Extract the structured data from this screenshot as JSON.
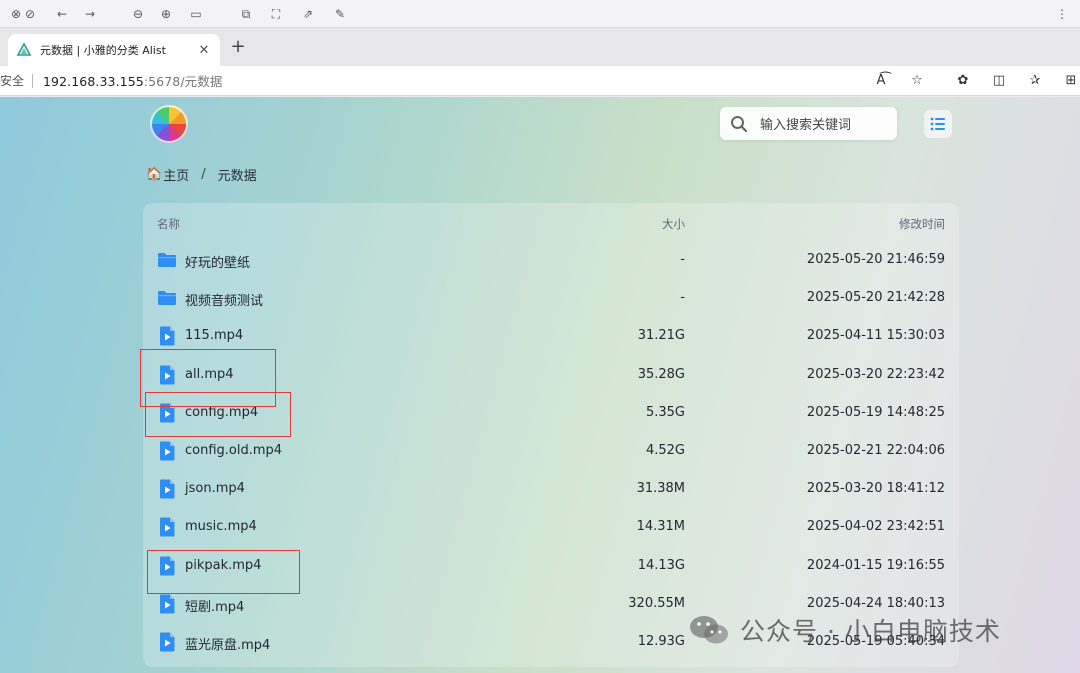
{
  "browser": {
    "tab_title": "元数据 | 小雅的分类 Alist",
    "new_tab": "+",
    "security_label": "安全",
    "url_host": "192.168.33.155",
    "url_rest": ":5678/元数据"
  },
  "header": {
    "search_placeholder": "输入搜索关键词"
  },
  "breadcrumb": {
    "home_label": "主页",
    "separator": "/",
    "current": "元数据"
  },
  "list": {
    "columns": {
      "name": "名称",
      "size": "大小",
      "modified": "修改时间"
    },
    "rows": [
      {
        "name": "好玩的壁纸",
        "size": "-",
        "modified": "2025-05-20 21:46:59",
        "type": "folder"
      },
      {
        "name": "视频音频测试",
        "size": "-",
        "modified": "2025-05-20 21:42:28",
        "type": "folder"
      },
      {
        "name": "115.mp4",
        "size": "31.21G",
        "modified": "2025-04-11 15:30:03",
        "type": "video"
      },
      {
        "name": "all.mp4",
        "size": "35.28G",
        "modified": "2025-03-20 22:23:42",
        "type": "video"
      },
      {
        "name": "config.mp4",
        "size": "5.35G",
        "modified": "2025-05-19 14:48:25",
        "type": "video"
      },
      {
        "name": "config.old.mp4",
        "size": "4.52G",
        "modified": "2025-02-21 22:04:06",
        "type": "video"
      },
      {
        "name": "json.mp4",
        "size": "31.38M",
        "modified": "2025-03-20 18:41:12",
        "type": "video"
      },
      {
        "name": "music.mp4",
        "size": "14.31M",
        "modified": "2025-04-02 23:42:51",
        "type": "video"
      },
      {
        "name": "pikpak.mp4",
        "size": "14.13G",
        "modified": "2024-01-15 19:16:55",
        "type": "video"
      },
      {
        "name": "短剧.mp4",
        "size": "320.55M",
        "modified": "2025-04-24 18:40:13",
        "type": "video"
      },
      {
        "name": "蓝光原盘.mp4",
        "size": "12.93G",
        "modified": "2025-05-19 05:40:34",
        "type": "video"
      }
    ]
  },
  "watermark": {
    "text": "公众号 · 小白电脑技术"
  },
  "colors": {
    "accent": "#2f8ef2",
    "highlight": "#e23a36"
  }
}
